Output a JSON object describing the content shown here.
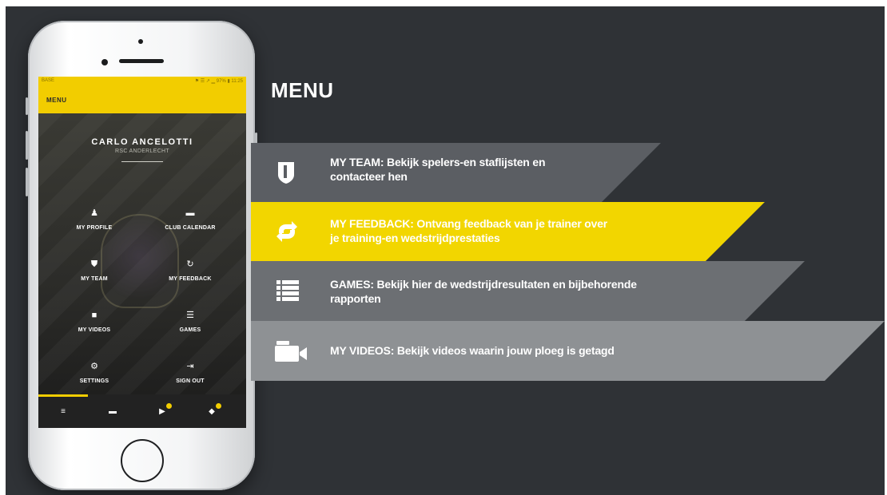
{
  "phone": {
    "status": {
      "carrier": "BASE",
      "right": "⚑ ☰ ↗ ▁ 97% ▮ 11:25"
    },
    "header": {
      "title": "MENU"
    },
    "profile": {
      "name": "CARLO ANCELOTTI",
      "club": "RSC ANDERLECHT"
    },
    "menu_items": [
      {
        "label": "MY PROFILE",
        "icon": "person-icon",
        "glyph": "♟"
      },
      {
        "label": "CLUB CALENDAR",
        "icon": "calendar-icon",
        "glyph": "▬"
      },
      {
        "label": "MY TEAM",
        "icon": "shield-icon",
        "glyph": "⛊"
      },
      {
        "label": "MY FEEDBACK",
        "icon": "refresh-icon",
        "glyph": "↻"
      },
      {
        "label": "MY VIDEOS",
        "icon": "video-camera-icon",
        "glyph": "■"
      },
      {
        "label": "GAMES",
        "icon": "list-icon",
        "glyph": "☰"
      },
      {
        "label": "SETTINGS",
        "icon": "gear-icon",
        "glyph": "⚙"
      },
      {
        "label": "SIGN OUT",
        "icon": "sign-out-icon",
        "glyph": "⇥"
      }
    ],
    "bottom_nav": [
      {
        "icon": "menu-icon",
        "glyph": "≡"
      },
      {
        "icon": "calendar-icon",
        "glyph": "▬"
      },
      {
        "icon": "chat-icon",
        "glyph": "▶"
      },
      {
        "icon": "chat-group-icon",
        "glyph": "◆"
      }
    ]
  },
  "panel": {
    "heading": "MENU",
    "features": [
      {
        "icon": "shield-icon",
        "line1": "MY TEAM: Bekijk spelers-en staflijsten en",
        "line2": "contacteer hen",
        "color": "#5b5e63",
        "text_color": "#ffffff"
      },
      {
        "icon": "refresh-icon",
        "line1": "MY FEEDBACK: Ontvang feedback van je trainer over",
        "line2": "je training-en wedstrijdprestaties",
        "color": "#f2d600",
        "text_color": "#ffffff"
      },
      {
        "icon": "list-icon",
        "line1": "GAMES: Bekijk hier de wedstrijdresultaten  en bijbehorende",
        "line2": "rapporten",
        "color": "#6c6f73",
        "text_color": "#ffffff"
      },
      {
        "icon": "video-camera-icon",
        "line1": "MY VIDEOS: Bekijk videos waarin jouw ploeg is getagd",
        "line2": "",
        "color": "#8e9194",
        "text_color": "#ffffff"
      }
    ]
  },
  "colors": {
    "background": "#2f3236",
    "accent": "#f2cd00"
  }
}
